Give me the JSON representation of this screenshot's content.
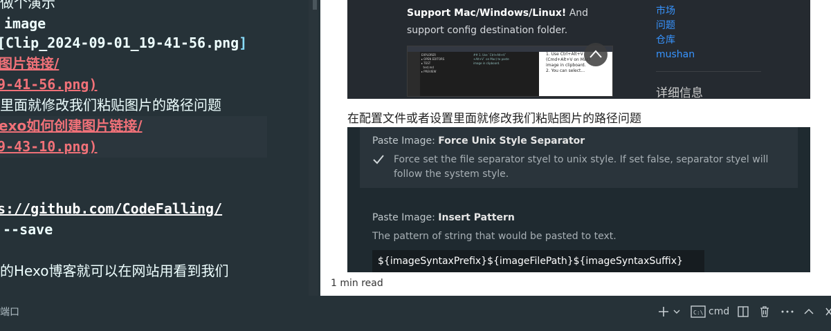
{
  "editor": {
    "lines": [
      "做个演示",
      "image",
      "[Clip_2024-09-01_19-41-56.png",
      "]",
      "图片链接/",
      "9-41-56.png)",
      "里面就修改我们粘贴图片的路径问题",
      "exo如何创建图片链接/",
      "9-43-10.png)",
      "s://github.com/CodeFalling/",
      "--save",
      "的Hexo博客就可以在网站用看到我们"
    ]
  },
  "preview": {
    "image1": {
      "bold_text": "Support Mac/Windows/Linux!",
      "text": " And support config destination folder.",
      "links": [
        "市场",
        "问题",
        "仓库",
        "mushan"
      ],
      "heading": "详细信息"
    },
    "paragraph": "在配置文件或者设置里面就修改我们粘贴图片的路径问题",
    "image2": {
      "setting1_prefix": "Paste Image: ",
      "setting1_name": "Force Unix Style Separator",
      "setting1_desc": "Force set the file separator styel to unix style. If set false, separator styel will follow the system style.",
      "setting2_prefix": "Paste Image: ",
      "setting2_name": "Insert Pattern",
      "setting2_desc": "The pattern of string that would be pasted to text.",
      "setting2_value": "${imageSyntaxPrefix}${imageFilePath}${imageSyntaxSuffix}"
    },
    "read_time": "1 min read"
  },
  "terminal": {
    "tab_fragment": "端口",
    "shell": "cmd"
  },
  "colors": {
    "editor_bg": "#263238",
    "link": "#f07178",
    "preview_link": "#3794ff"
  }
}
